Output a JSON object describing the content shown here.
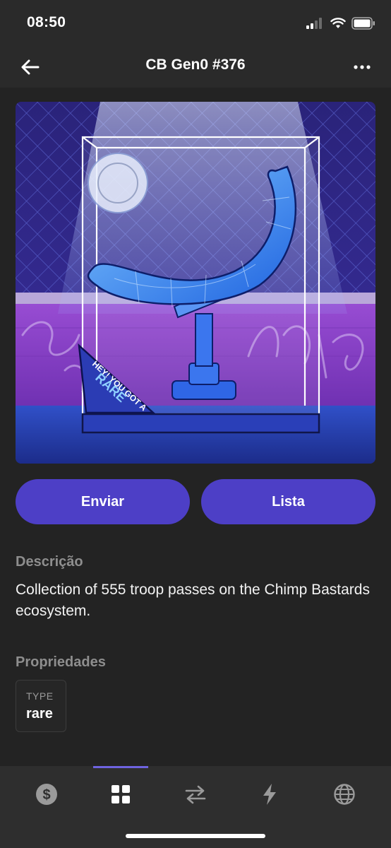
{
  "status_bar": {
    "time": "08:50",
    "signal_icon": "signal-icon",
    "wifi_icon": "wifi-icon",
    "battery_icon": "battery-icon"
  },
  "header": {
    "title": "CB Gen0 #376",
    "back_icon": "arrow-left-icon",
    "more_icon": "more-horizontal-icon"
  },
  "artwork": {
    "description_icon": "nft-artwork-image",
    "ribbon_text_line1": "HEY! YOU GOT A",
    "ribbon_text_line2": "RARE",
    "graffiti_text": "Chimp"
  },
  "actions": {
    "send_label": "Enviar",
    "list_label": "Lista"
  },
  "description": {
    "heading": "Descrição",
    "text": "Collection of 555 troop passes on the Chimp Bastards ecosystem."
  },
  "properties": {
    "heading": "Propriedades",
    "items": [
      {
        "type": "TYPE",
        "value": "rare"
      }
    ]
  },
  "bottom_nav": {
    "items": [
      {
        "name": "balance",
        "icon": "dollar-coin-icon",
        "active": false
      },
      {
        "name": "collectibles",
        "icon": "grid-icon",
        "active": true
      },
      {
        "name": "swap",
        "icon": "swap-arrows-icon",
        "active": false
      },
      {
        "name": "activity",
        "icon": "lightning-icon",
        "active": false
      },
      {
        "name": "browser",
        "icon": "globe-icon",
        "active": false
      }
    ]
  },
  "colors": {
    "accent": "#4d3fc6",
    "background": "#232323",
    "header": "#2a2a2a",
    "nav_active": "#6e63e0"
  }
}
